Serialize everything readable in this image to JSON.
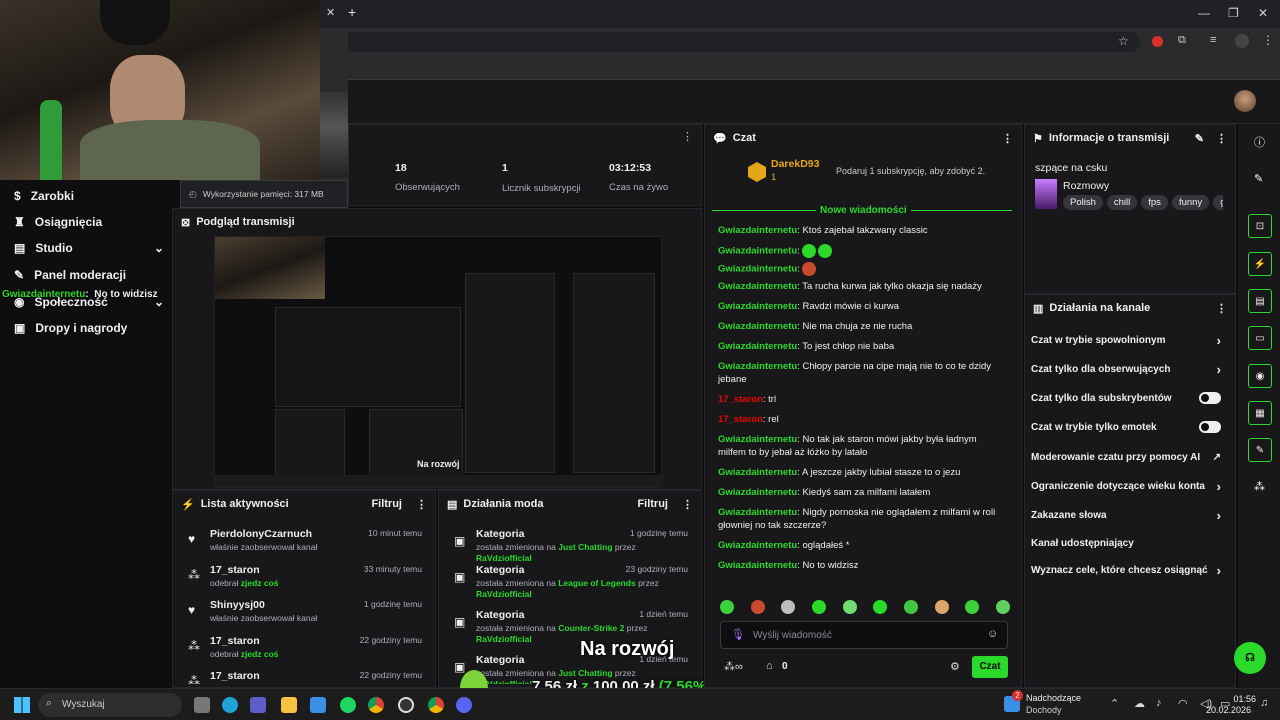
{
  "browser": {
    "new_tab": "+"
  },
  "webcam": {
    "memory_label": "Wykorzystanie pamięci: 317 MB"
  },
  "overlay": {
    "user": "Gwiazdainternetu",
    "message": "No to widzisz",
    "dev_title": "Na rozwój",
    "dev_current": "7,56 zł",
    "dev_z": "z",
    "dev_goal": "100,00 zł",
    "dev_pct": "(7.56%)"
  },
  "nav": {
    "items": [
      {
        "label": "Zarobki",
        "icon": "dollar-icon"
      },
      {
        "label": "Osiągnięcia",
        "icon": "trophy-icon"
      },
      {
        "label": "Studio",
        "icon": "studio-icon"
      },
      {
        "label": "Panel moderacji",
        "icon": "wrench-icon"
      },
      {
        "label": "Społeczność",
        "icon": "community-icon"
      },
      {
        "label": "Dropy i nagrody",
        "icon": "gift-icon"
      }
    ]
  },
  "stats": [
    {
      "value": "18",
      "label": "Obserwujących"
    },
    {
      "value": "1",
      "label": "Licznik subskrypcji"
    },
    {
      "value": "03:12:53",
      "label": "Czas na żywo"
    }
  ],
  "preview": {
    "title": "Podgląd transmisji",
    "inner_label": "Na rozwój"
  },
  "activity": {
    "title": "Lista aktywności",
    "filter": "Filtruj",
    "rows": [
      {
        "name": "PierdolonyCzarnuch",
        "desc": "właśnie zaobserwował kanał",
        "time": "10 minut temu",
        "icon": "heart-icon"
      },
      {
        "name": "17_staron",
        "desc": "odebrał",
        "desc_hl": "zjedz coś",
        "time": "33 minuty temu",
        "icon": "channel-points-icon"
      },
      {
        "name": "Shinyysj00",
        "desc": "właśnie zaobserwował kanał",
        "time": "1 godzinę temu",
        "icon": "heart-icon"
      },
      {
        "name": "17_staron",
        "desc": "odebrał",
        "desc_hl": "zjedz coś",
        "time": "22 godziny temu",
        "icon": "channel-points-icon"
      },
      {
        "name": "17_staron",
        "desc": "",
        "time": "22 godziny temu",
        "icon": "channel-points-icon"
      }
    ]
  },
  "mod": {
    "title": "Działania moda",
    "filter": "Filtruj",
    "rows": [
      {
        "name": "Kategoria",
        "pre": "została zmieniona na",
        "cat": "Just Chatting",
        "by": "przez",
        "user": "RaVdziofficial",
        "time": "1 godzinę temu"
      },
      {
        "name": "Kategoria",
        "pre": "została zmieniona na",
        "cat": "League of Legends",
        "by": "przez",
        "user": "RaVdziofficial",
        "time": "23 godziny temu"
      },
      {
        "name": "Kategoria",
        "pre": "została zmieniona na",
        "cat": "Counter-Strike 2",
        "by": "przez",
        "user": "RaVdziofficial",
        "time": "1 dzień temu"
      },
      {
        "name": "Kategoria",
        "pre": "została zmieniona na",
        "cat": "Just Chatting",
        "by": "przez",
        "user": "RaVdziofficial",
        "time": "1 dzień temu"
      }
    ]
  },
  "chat": {
    "title": "Czat",
    "pinned_user": "DarekD93",
    "pinned_count": "1",
    "sub_prompt": "Podaruj 1 subskrypcję, aby zdobyć 2.",
    "new_messages": "Nowe wiadomości",
    "messages": [
      {
        "user": "Gwiazdainternetu",
        "text": "Ktoś zajebał takzwany classic",
        "red": false
      },
      {
        "user": "Gwiazdainternetu",
        "text": "",
        "red": false,
        "emotes": 2
      },
      {
        "user": "Gwiazdainternetu",
        "text": "",
        "red": false,
        "emotes": 1
      },
      {
        "user": "Gwiazdainternetu",
        "text": "Ta rucha kurwa jak tylko okazja się nadaży",
        "red": false
      },
      {
        "user": "Gwiazdainternetu",
        "text": "Ravdzi mówie ci kurwa",
        "red": false
      },
      {
        "user": "Gwiazdainternetu",
        "text": "Nie ma chuja ze nie rucha",
        "red": false
      },
      {
        "user": "Gwiazdainternetu",
        "text": "To jest chłop nie baba",
        "red": false
      },
      {
        "user": "Gwiazdainternetu",
        "text": "Chłopy parcie na cipe mają nie to co te dzidy jebane",
        "red": false
      },
      {
        "user": "17_staron",
        "text": "trl",
        "red": true
      },
      {
        "user": "17_staron",
        "text": "rel",
        "red": true
      },
      {
        "user": "Gwiazdainternetu",
        "text": "No tak jak staron mówi jakby była ładnym milfem to by jebał aż łóżko by latało",
        "red": false
      },
      {
        "user": "Gwiazdainternetu",
        "text": "A jeszcze jakby lubiał stasze to o jezu",
        "red": false
      },
      {
        "user": "Gwiazdainternetu",
        "text": "Kiedyś sam za milfami latałem",
        "red": false
      },
      {
        "user": "Gwiazdainternetu",
        "text": "Nigdy pornoska nie oglądałem z milfami w roli głowniej no tak szczerze?",
        "red": false
      },
      {
        "user": "Gwiazdainternetu",
        "text": "oglądałeś *",
        "red": false
      },
      {
        "user": "Gwiazdainternetu",
        "text": "No to widzisz",
        "red": false
      }
    ],
    "input_placeholder": "Wyślij wiadomość",
    "points_count": "0",
    "send": "Czat"
  },
  "info": {
    "title": "Informacje o transmisji",
    "stream_title": "szpące na csku",
    "category": "Rozmowy",
    "tags": [
      "Polish",
      "chill",
      "fps",
      "funny",
      "ga"
    ]
  },
  "actions": {
    "title": "Działania na kanale",
    "items": [
      {
        "label": "Czat w trybie spowolnionym",
        "ctrl": "chevron"
      },
      {
        "label": "Czat tylko dla obserwujących",
        "ctrl": "chevron"
      },
      {
        "label": "Czat tylko dla subskrybentów",
        "ctrl": "toggle"
      },
      {
        "label": "Czat w trybie tylko emotek",
        "ctrl": "toggle"
      },
      {
        "label": "Moderowanie czatu przy pomocy AI",
        "ctrl": "external"
      },
      {
        "label": "Ograniczenie dotyczące wieku konta",
        "ctrl": "chevron"
      },
      {
        "label": "Zakazane słowa",
        "ctrl": "chevron"
      },
      {
        "label": "Kanał udostępniający",
        "ctrl": "none"
      },
      {
        "label": "Wyznacz cele, które chcesz osiągnąć",
        "ctrl": "chevron"
      }
    ]
  },
  "taskbar": {
    "search": "Wyszukaj",
    "weather_title": "Nadchodzące",
    "weather_sub": "Dochody",
    "weather_badge": "2",
    "time": "01:56",
    "date": "20.02.2026"
  },
  "colors": {
    "accent": "#2bd92b",
    "bg": "#0e0e10",
    "panel": "#18181b",
    "danger": "#eb0400"
  }
}
